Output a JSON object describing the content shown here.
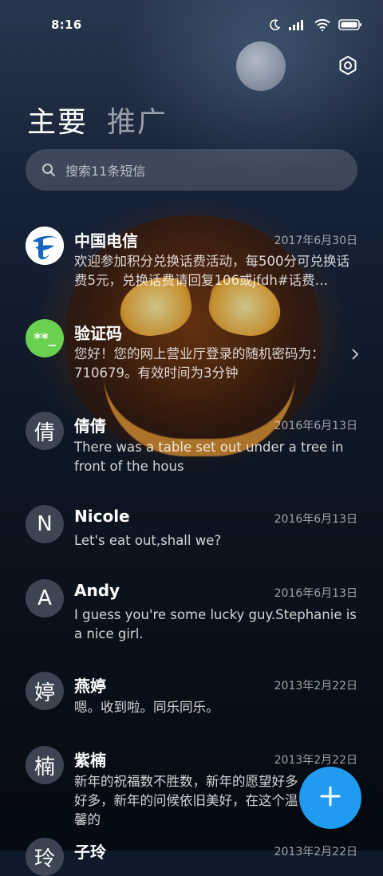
{
  "status_bar": {
    "time": "8:16"
  },
  "header": {
    "tabs": [
      {
        "label": "主要",
        "active": true
      },
      {
        "label": "推广",
        "active": false
      }
    ]
  },
  "search": {
    "placeholder": "搜索11条短信"
  },
  "conversations": [
    {
      "name": "中国电信",
      "date": "2017年6月30日",
      "preview": "欢迎参加积分兑换话费活动，每500分可兑换话费5元，兑换话费请回复106或jfdh#话费…",
      "avatar_type": "telecom-logo"
    },
    {
      "name": "验证码",
      "date": "",
      "preview": "您好！您的网上营业厅登录的随机密码为：710679。有效时间为3分钟",
      "avatar_type": "verification",
      "avatar_text": "**_"
    },
    {
      "name": "倩倩",
      "date": "2016年6月13日",
      "preview": "There was a table set out under a tree in front of the hous",
      "avatar_text": "倩"
    },
    {
      "name": "Nicole",
      "date": "2016年6月13日",
      "preview": "Let's eat out,shall we?",
      "avatar_text": "N"
    },
    {
      "name": "Andy",
      "date": "2016年6月13日",
      "preview": "I guess you're some lucky guy.Stephanie is a nice girl.",
      "avatar_text": "A"
    },
    {
      "name": "燕婷",
      "date": "2013年2月22日",
      "preview": "嗯。收到啦。同乐同乐。",
      "avatar_text": "婷"
    },
    {
      "name": "紫楠",
      "date": "2013年2月22日",
      "preview": "新年的祝福数不胜数，新年的愿望好多好多，新年的问候依旧美好，在这个温馨的",
      "avatar_text": "楠"
    },
    {
      "name": "子玲",
      "date": "2013年2月22日",
      "preview": "",
      "avatar_text": "玲"
    }
  ],
  "colors": {
    "accent": "#1f9bef",
    "verify_green": "#6ad04f",
    "telecom_blue": "#1565c0"
  },
  "icons": {
    "settings": "gear-icon",
    "search": "search-icon",
    "compose": "plus-icon",
    "chevron": "chevron-right-icon"
  }
}
